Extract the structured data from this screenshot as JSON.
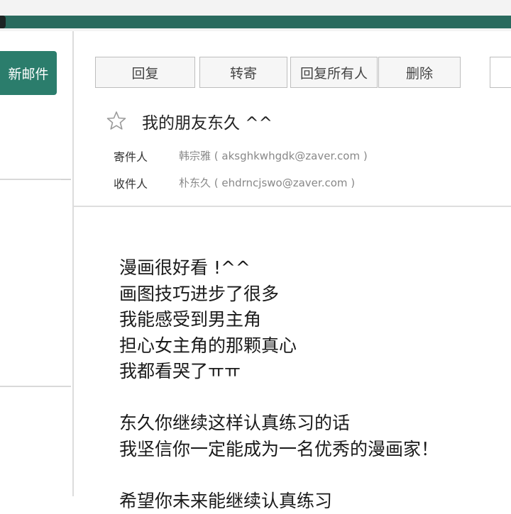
{
  "sidebar": {
    "compose_label": "新邮件"
  },
  "toolbar": {
    "buttons": [
      "回复",
      "转寄",
      "回复所有人",
      "删除"
    ]
  },
  "email": {
    "subject": "我的朋友东久 ^^",
    "sender_label": "寄件人",
    "sender_value": "韩宗雅 ( aksghkwhgdk@zaver.com )",
    "recipient_label": "收件人",
    "recipient_value": "朴东久 ( ehdrncjswo@zaver.com )",
    "body_lines": [
      "漫画很好看 !^^",
      "画图技巧进步了很多",
      "我能感受到男主角",
      "担心女主角的那颗真心",
      "我都看哭了ㅠㅠ",
      "",
      "东久你继续这样认真练习的话",
      "我坚信你一定能成为一名优秀的漫画家！",
      "",
      "希望你未来能继续认真练习"
    ]
  },
  "colors": {
    "accent_green": "#2b7d6c",
    "top_strip": "#2a6a5e"
  },
  "icons": {
    "star": "star-icon"
  }
}
